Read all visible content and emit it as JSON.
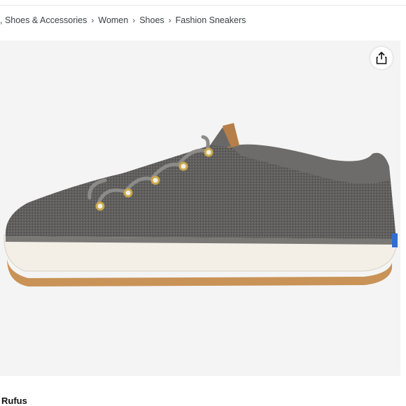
{
  "breadcrumb": {
    "items": [
      ", Shoes & Accessories",
      "Women",
      "Shoes",
      "Fashion Sneakers"
    ],
    "separator": "›"
  },
  "product": {
    "image_subject": "gray heathered canvas lace-up sneaker",
    "share_icon": "share-icon"
  },
  "footer": {
    "seller": "Rufus"
  },
  "colors": {
    "canvas": "#5f5d5b",
    "sole": "#f3efe6",
    "outsole": "#c99357",
    "collar": "#6e6c6a",
    "laces": "#8d8b88",
    "eyelets": "#c9a84c",
    "heel_tab": "#b67f49",
    "badge": "#2f6fcf"
  }
}
